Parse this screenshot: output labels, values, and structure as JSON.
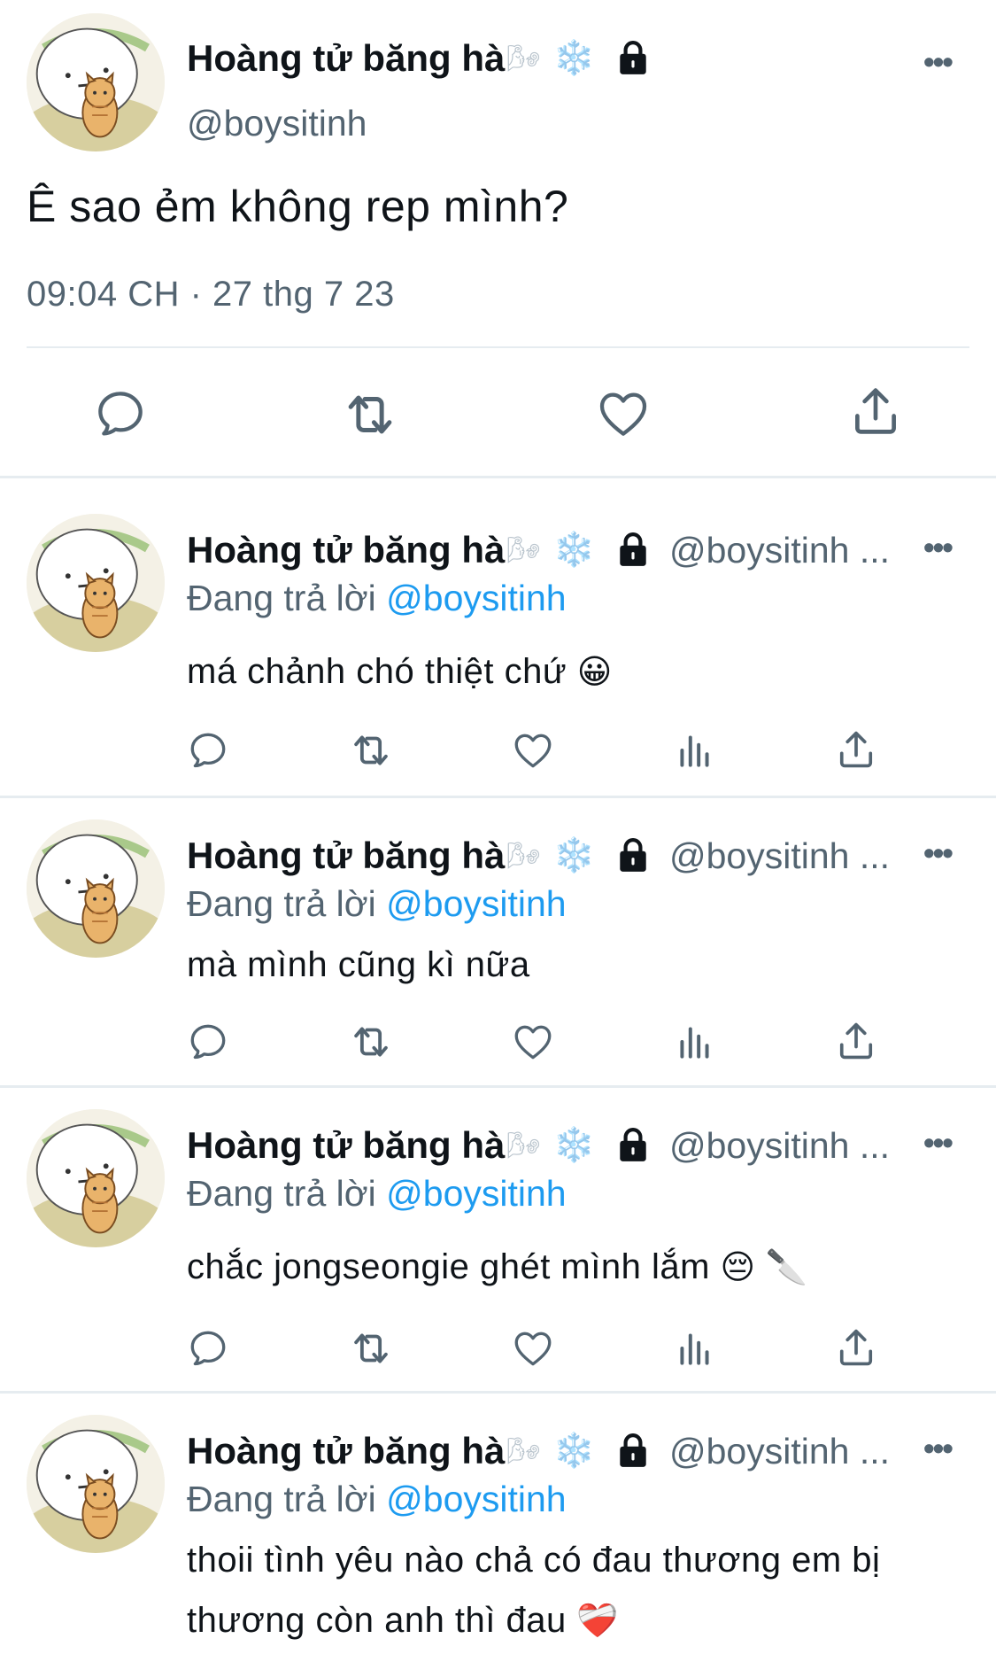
{
  "colors": {
    "text": "#0f1419",
    "secondary": "#536471",
    "link": "#1d9bf0",
    "divider": "#e6ecf0"
  },
  "main_tweet": {
    "display_name": "Hoàng tử băng hà",
    "name_deco": "🌬",
    "name_flake": "❄️",
    "handle": "@boysitinh",
    "text": "Ê sao ẻm không rep mình?",
    "timestamp": "09:04 CH · 27 thg 7 23",
    "actions": [
      "reply-icon",
      "retweet-icon",
      "like-icon",
      "share-icon"
    ]
  },
  "replies": [
    {
      "display_name": "Hoàng tử băng hà",
      "name_deco": "🌬",
      "name_flake": "❄️",
      "handle": "@boysitinh ...",
      "replying_prefix": "Đang trả lời ",
      "replying_to": "@boysitinh",
      "text": "má chảnh chó thiệt chứ",
      "emoji": "😀"
    },
    {
      "display_name": "Hoàng tử băng hà",
      "name_deco": "🌬",
      "name_flake": "❄️",
      "handle": "@boysitinh ...",
      "replying_prefix": "Đang trả lời ",
      "replying_to": "@boysitinh",
      "text": "mà mình cũng kì nữa",
      "emoji": ""
    },
    {
      "display_name": "Hoàng tử băng hà",
      "name_deco": "🌬",
      "name_flake": "❄️",
      "handle": "@boysitinh ...",
      "replying_prefix": "Đang trả lời ",
      "replying_to": "@boysitinh",
      "text": "chắc jongseongie ghét mình lắm",
      "emoji": "😔 🔪"
    },
    {
      "display_name": "Hoàng tử băng hà",
      "name_deco": "🌬",
      "name_flake": "❄️",
      "handle": "@boysitinh ...",
      "replying_prefix": "Đang trả lời ",
      "replying_to": "@boysitinh",
      "text": "thoii tình yêu nào chả có đau thương em bị thương còn anh thì đau",
      "emoji": "❤️‍🩹"
    }
  ],
  "reply_actions": [
    "reply-icon",
    "retweet-icon",
    "like-icon",
    "views-icon",
    "share-icon"
  ],
  "more_glyph": "•••"
}
